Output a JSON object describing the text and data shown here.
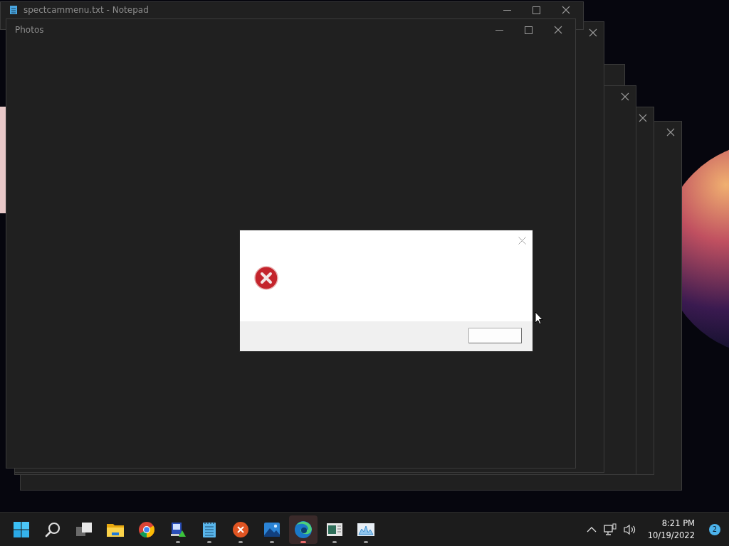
{
  "background_window": {
    "title": "spectcammenu.txt - Notepad"
  },
  "photos_window": {
    "title": "Photos"
  },
  "taskbar": {
    "apps": [
      {
        "kind": "start",
        "running": false,
        "selected": false
      },
      {
        "kind": "search",
        "running": false,
        "selected": false
      },
      {
        "kind": "taskview",
        "running": false,
        "selected": false
      },
      {
        "kind": "explorer",
        "running": false,
        "selected": false
      },
      {
        "kind": "chrome",
        "running": false,
        "selected": false
      },
      {
        "kind": "remote",
        "running": true,
        "selected": false
      },
      {
        "kind": "notepad",
        "running": true,
        "selected": false
      },
      {
        "kind": "xapp",
        "running": true,
        "selected": false
      },
      {
        "kind": "photos",
        "running": true,
        "selected": false
      },
      {
        "kind": "edge",
        "running": true,
        "selected": true
      },
      {
        "kind": "panel",
        "running": true,
        "selected": false
      },
      {
        "kind": "monitor",
        "running": true,
        "selected": false
      }
    ],
    "time": "8:21 PM",
    "date": "10/19/2022",
    "notifications": "2"
  }
}
